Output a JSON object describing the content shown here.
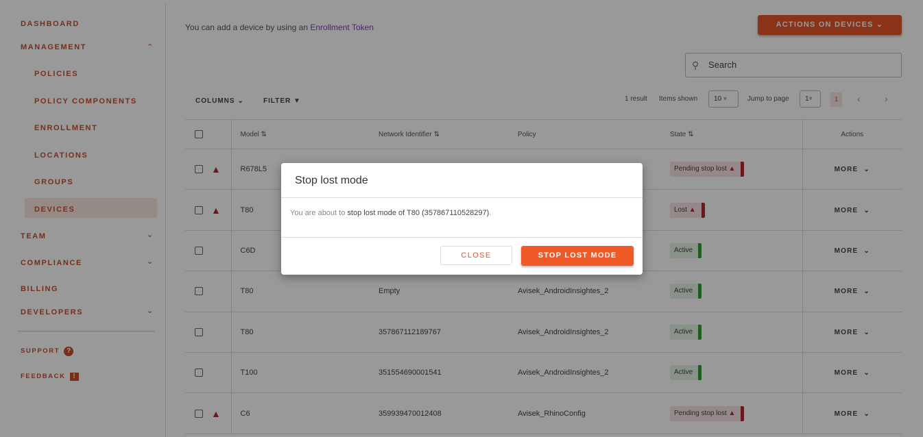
{
  "sidebar": {
    "items": [
      {
        "label": "DASHBOARD"
      },
      {
        "label": "MANAGEMENT"
      },
      {
        "label": "POLICIES"
      },
      {
        "label": "POLICY COMPONENTS"
      },
      {
        "label": "ENROLLMENT"
      },
      {
        "label": "LOCATIONS"
      },
      {
        "label": "GROUPS"
      },
      {
        "label": "DEVICES"
      },
      {
        "label": "TEAM"
      },
      {
        "label": "COMPLIANCE"
      },
      {
        "label": "BILLING"
      },
      {
        "label": "DEVELOPERS"
      }
    ],
    "support": "SUPPORT",
    "feedback": "FEEDBACK"
  },
  "header": {
    "hint_prefix": "You can add a device by using an",
    "hint_link": "Enrollment Token",
    "actions_button": "ACTIONS ON DEVICES",
    "search_placeholder": "Search"
  },
  "toolbar": {
    "columns": "COLUMNS",
    "filter": "FILTER",
    "result_count": "1 result",
    "items_shown_label": "Items shown",
    "items_shown_value": "10",
    "jump_label": "Jump to page",
    "jump_value": "1",
    "current_page": "1"
  },
  "table": {
    "headers": [
      "Model",
      "Network Identifier",
      "Policy",
      "State",
      "Actions"
    ],
    "more_label": "MORE",
    "rows": [
      {
        "model": "R678L5",
        "network": "",
        "policy": "",
        "state": "Pending stop lost",
        "state_type": "pending",
        "warning": true
      },
      {
        "model": "T80",
        "network": "",
        "policy": "",
        "state": "Lost",
        "state_type": "lost",
        "warning": true
      },
      {
        "model": "C6D",
        "network": "",
        "policy": "",
        "state": "Active",
        "state_type": "active",
        "warning": false
      },
      {
        "model": "T80",
        "network": "Empty",
        "policy": "Avisek_AndroidInsightes_2",
        "state": "Active",
        "state_type": "active",
        "warning": false
      },
      {
        "model": "T80",
        "network": "357867112189767",
        "policy": "Avisek_AndroidInsightes_2",
        "state": "Active",
        "state_type": "active",
        "warning": false
      },
      {
        "model": "T100",
        "network": "351554690001541",
        "policy": "Avisek_AndroidInsightes_2",
        "state": "Active",
        "state_type": "active",
        "warning": false
      },
      {
        "model": "C6",
        "network": "359939470012408",
        "policy": "Avisek_RhinoConfig",
        "state": "Pending stop lost",
        "state_type": "pending",
        "warning": true
      }
    ]
  },
  "modal": {
    "title": "Stop lost mode",
    "body_prefix": "You are about to",
    "body_bold": "stop lost mode of T80 (357867110528297)",
    "body_suffix": ".",
    "close": "CLOSE",
    "confirm": "STOP LOST MODE"
  },
  "colors": {
    "accent": "#e8552a",
    "danger": "#b5272d",
    "success": "#3a9a3a",
    "link": "#7b3fb0"
  }
}
